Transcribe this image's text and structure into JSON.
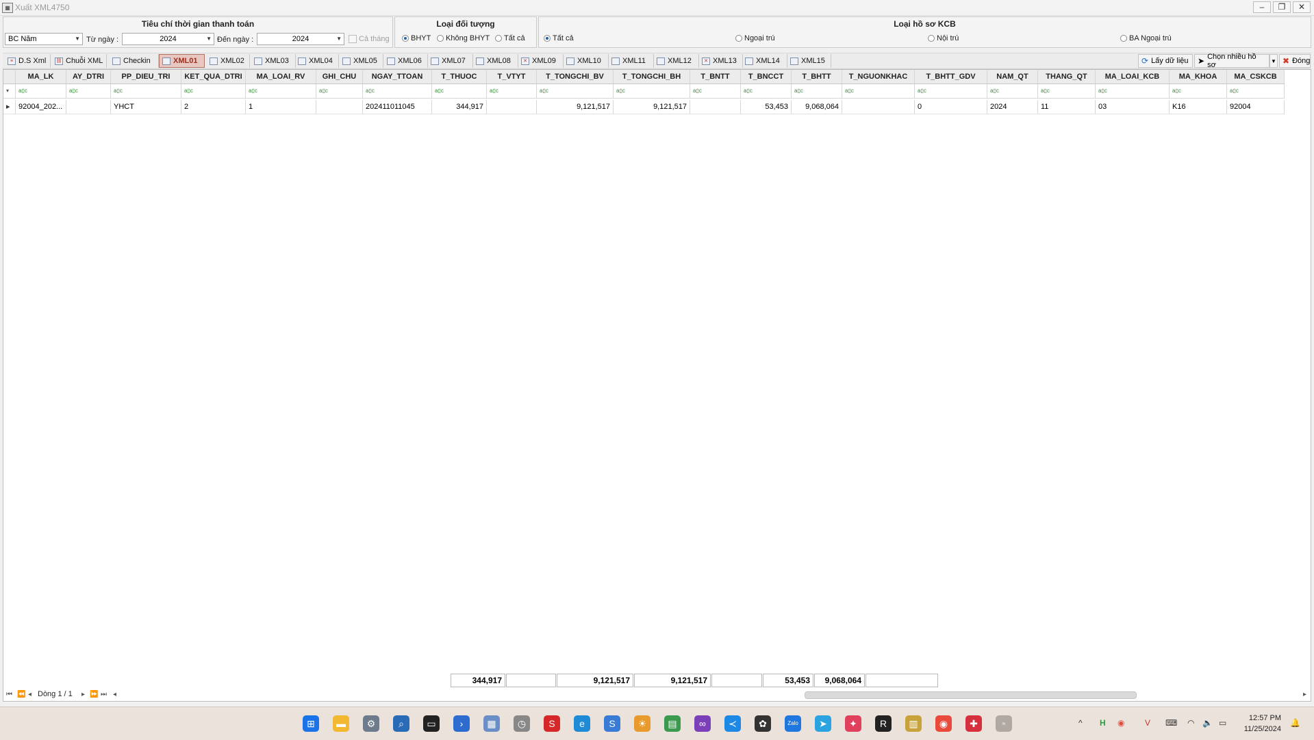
{
  "window": {
    "title": "Xuất XML4750",
    "minimize": "–",
    "restore": "❐",
    "close": "✕"
  },
  "filters": {
    "time_group_title": "Tiêu chí thời gian thanh toán",
    "report_type": "BC Năm",
    "from_label": "Từ ngày :",
    "from_value": "2024",
    "to_label": "Đến ngày :",
    "to_value": "2024",
    "whole_month_label": "Cả tháng",
    "object_group_title": "Loại đối tượng",
    "object_options": [
      "BHYT",
      "Không BHYT",
      "Tất cả"
    ],
    "object_selected": "BHYT",
    "kcb_group_title": "Loại hồ sơ KCB",
    "kcb_options": [
      "Tất cả",
      "Ngoại trú",
      "Nội trú",
      "BA Ngoại trú"
    ],
    "kcb_selected": "Tất cả"
  },
  "tabs": [
    "D.S Xml",
    "Chuỗi XML",
    "Checkin",
    "XML01",
    "XML02",
    "XML03",
    "XML04",
    "XML05",
    "XML06",
    "XML07",
    "XML08",
    "XML09",
    "XML10",
    "XML11",
    "XML12",
    "XML13",
    "XML14",
    "XML15"
  ],
  "active_tab": "XML01",
  "actions": {
    "fetch": "Lấy dữ liệu",
    "multi_select": "Chọn nhiều hồ sơ",
    "close": "Đóng"
  },
  "grid": {
    "columns": [
      "MA_LK",
      "AY_DTRI",
      "PP_DIEU_TRI",
      "KET_QUA_DTRI",
      "MA_LOAI_RV",
      "GHI_CHU",
      "NGAY_TTOAN",
      "T_THUOC",
      "T_VTYT",
      "T_TONGCHI_BV",
      "T_TONGCHI_BH",
      "T_BNTT",
      "T_BNCCT",
      "T_BHTT",
      "T_NGUONKHAC",
      "T_BHTT_GDV",
      "NAM_QT",
      "THANG_QT",
      "MA_LOAI_KCB",
      "MA_KHOA",
      "MA_CSKCB"
    ],
    "filter_placeholder": "a▯c",
    "rows": [
      [
        "92004_202...",
        "",
        "YHCT",
        "2",
        "1",
        "",
        "202411011045",
        "344,917",
        "",
        "9,121,517",
        "9,121,517",
        "",
        "53,453",
        "9,068,064",
        "",
        "0",
        "2024",
        "11",
        "03",
        "K16",
        "92004"
      ]
    ],
    "totals": {
      "T_THUOC": "344,917",
      "T_TONGCHI_BV": "9,121,517",
      "T_TONGCHI_BH": "9,121,517",
      "T_BNCCT": "53,453",
      "T_BHTT": "9,068,064"
    },
    "nav_text": "Dòng 1 / 1"
  },
  "taskbar": {
    "time": "12:57 PM",
    "date": "11/25/2024",
    "zalo": "Zalo"
  }
}
